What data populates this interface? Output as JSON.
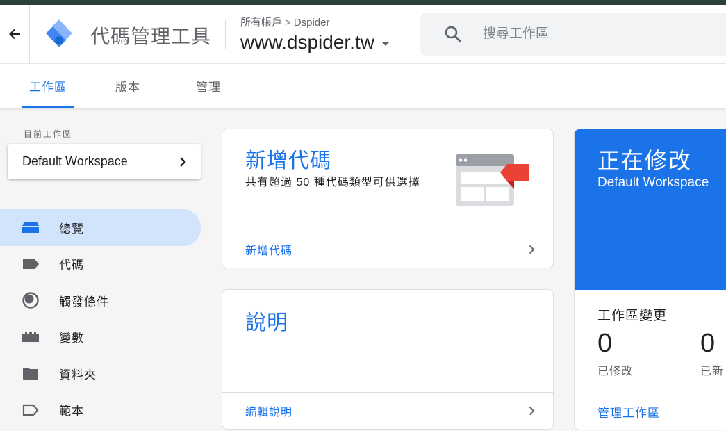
{
  "app": {
    "title": "代碼管理工具",
    "breadcrumb_root": "所有帳戶",
    "breadcrumb_separator": ">",
    "account": "Dspider",
    "container": "www.dspider.tw",
    "search_placeholder": "搜尋工作區"
  },
  "tabs": [
    {
      "label": "工作區",
      "active": true
    },
    {
      "label": "版本",
      "active": false
    },
    {
      "label": "管理",
      "active": false
    }
  ],
  "sidebar": {
    "workspace_label": "目前工作區",
    "workspace_name": "Default Workspace",
    "items": [
      {
        "label": "總覽",
        "icon": "overview-icon",
        "active": true
      },
      {
        "label": "代碼",
        "icon": "tag-icon",
        "active": false
      },
      {
        "label": "觸發條件",
        "icon": "trigger-icon",
        "active": false
      },
      {
        "label": "變數",
        "icon": "variable-icon",
        "active": false
      },
      {
        "label": "資料夾",
        "icon": "folder-icon",
        "active": false
      },
      {
        "label": "範本",
        "icon": "template-icon",
        "active": false
      }
    ]
  },
  "new_tag_card": {
    "title": "新增代碼",
    "description": "共有超過 50 種代碼類型可供選擇",
    "footer": "新增代碼"
  },
  "help_card": {
    "title": "說明",
    "footer": "編輯說明"
  },
  "status_card": {
    "heading": "正在修改",
    "workspace": "Default Workspace",
    "changes_label": "工作區變更",
    "stats": [
      {
        "value": "0",
        "label": "已修改"
      },
      {
        "value": "0",
        "label": "已新"
      }
    ],
    "footer": "管理工作區"
  },
  "colors": {
    "accent": "#1a73e8",
    "active_nav": "#d2e3fc",
    "top_strip": "#2d3f3a",
    "tag_red": "#ea4335"
  }
}
